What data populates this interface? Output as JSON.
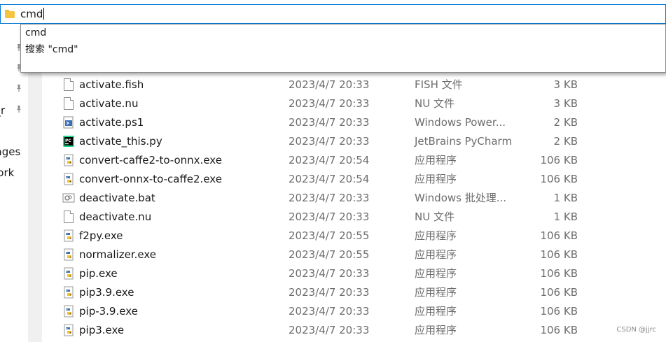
{
  "address_bar": {
    "value": "cmd"
  },
  "autocomplete": {
    "items": [
      {
        "label": "cmd"
      },
      {
        "label": "搜索 \"cmd\""
      }
    ]
  },
  "nav_pane": {
    "items": [
      {
        "label": "n_r"
      },
      {
        "label": "nages"
      },
      {
        "label": "work"
      }
    ]
  },
  "files": [
    {
      "name": "activate.fish",
      "date": "2023/4/7 20:33",
      "type": "FISH 文件",
      "size": "3 KB",
      "icon": "generic-file-icon"
    },
    {
      "name": "activate.nu",
      "date": "2023/4/7 20:33",
      "type": "NU 文件",
      "size": "3 KB",
      "icon": "generic-file-icon"
    },
    {
      "name": "activate.ps1",
      "date": "2023/4/7 20:33",
      "type": "Windows Power...",
      "size": "2 KB",
      "icon": "powershell-file-icon"
    },
    {
      "name": "activate_this.py",
      "date": "2023/4/7 20:33",
      "type": "JetBrains PyCharm",
      "size": "2 KB",
      "icon": "pycharm-file-icon"
    },
    {
      "name": "convert-caffe2-to-onnx.exe",
      "date": "2023/4/7 20:54",
      "type": "应用程序",
      "size": "106 KB",
      "icon": "python-exe-icon"
    },
    {
      "name": "convert-onnx-to-caffe2.exe",
      "date": "2023/4/7 20:54",
      "type": "应用程序",
      "size": "106 KB",
      "icon": "python-exe-icon"
    },
    {
      "name": "deactivate.bat",
      "date": "2023/4/7 20:33",
      "type": "Windows 批处理...",
      "size": "1 KB",
      "icon": "batch-file-icon"
    },
    {
      "name": "deactivate.nu",
      "date": "2023/4/7 20:33",
      "type": "NU 文件",
      "size": "1 KB",
      "icon": "generic-file-icon"
    },
    {
      "name": "f2py.exe",
      "date": "2023/4/7 20:55",
      "type": "应用程序",
      "size": "106 KB",
      "icon": "python-exe-icon"
    },
    {
      "name": "normalizer.exe",
      "date": "2023/4/7 20:55",
      "type": "应用程序",
      "size": "106 KB",
      "icon": "python-exe-icon"
    },
    {
      "name": "pip.exe",
      "date": "2023/4/7 20:33",
      "type": "应用程序",
      "size": "106 KB",
      "icon": "python-exe-icon"
    },
    {
      "name": "pip3.9.exe",
      "date": "2023/4/7 20:33",
      "type": "应用程序",
      "size": "106 KB",
      "icon": "python-exe-icon"
    },
    {
      "name": "pip-3.9.exe",
      "date": "2023/4/7 20:33",
      "type": "应用程序",
      "size": "106 KB",
      "icon": "python-exe-icon"
    },
    {
      "name": "pip3.exe",
      "date": "2023/4/7 20:33",
      "type": "应用程序",
      "size": "106 KB",
      "icon": "python-exe-icon"
    }
  ],
  "watermark": "CSDN @jjrc",
  "colors": {
    "focus_border": "#0078d7",
    "secondary_text": "#6d6d6d",
    "folder_yellow": "#f5c542"
  }
}
